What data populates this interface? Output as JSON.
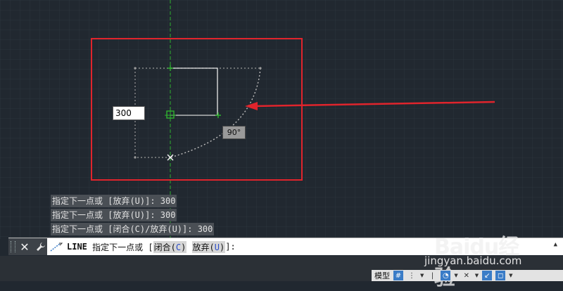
{
  "canvas": {
    "dimension_input_value": "300",
    "angle_tooltip": "90°"
  },
  "history": [
    "指定下一点或 [放弃(U)]: 300",
    "指定下一点或 [放弃(U)]: 300",
    "指定下一点或 [闭合(C)/放弃(U)]: 300"
  ],
  "command_line": {
    "command": "LINE",
    "prompt": " 指定下一点或 [",
    "option1_label": "闭合(",
    "option1_key": "C",
    "option1_end": ")",
    "option2_label": "放弃(",
    "option2_key": "U",
    "option2_end": ")",
    "suffix": "]:"
  },
  "status_bar": {
    "model_tab": "模型"
  },
  "watermark": {
    "logo_text": "Baidu经验",
    "url": "jingyan.baidu.com"
  },
  "colors": {
    "background": "#212830",
    "highlight_box": "#e0242c",
    "ucs_axis": "#2fb12f",
    "drawn_line": "#e6e6e6"
  }
}
